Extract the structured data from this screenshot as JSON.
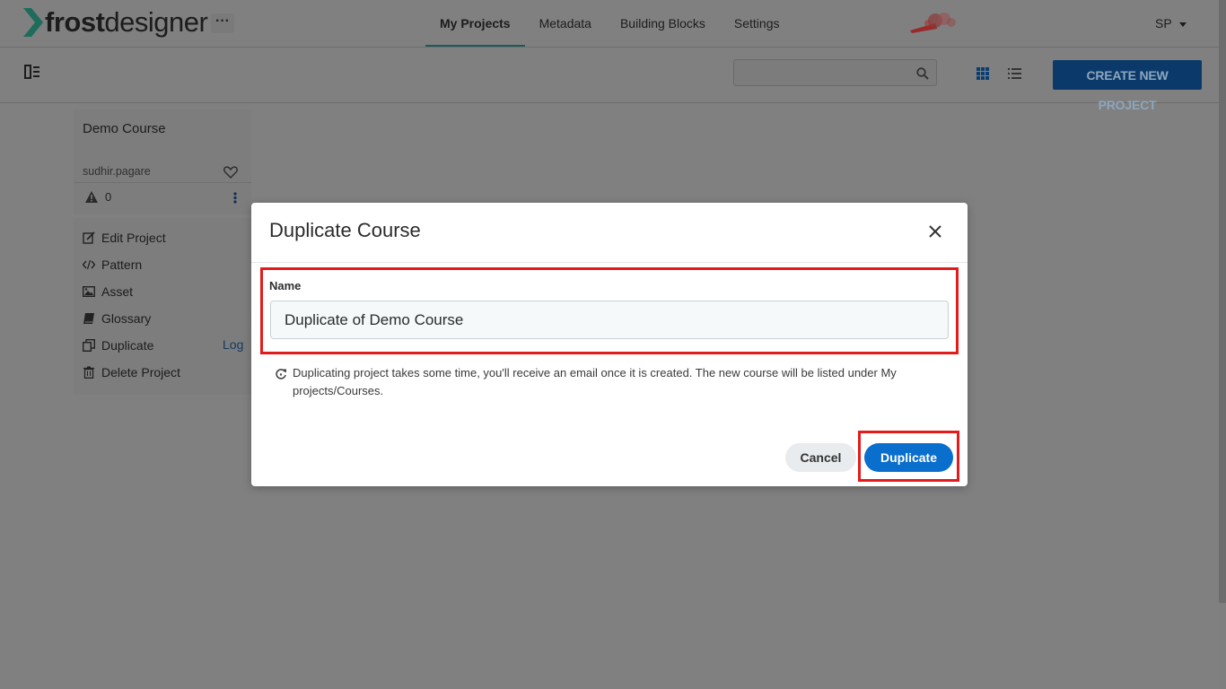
{
  "header": {
    "logo_bold": "frost",
    "logo_light": "designer",
    "more_label": "···",
    "nav": [
      {
        "label": "My Projects",
        "active": true
      },
      {
        "label": "Metadata",
        "active": false
      },
      {
        "label": "Building Blocks",
        "active": false
      },
      {
        "label": "Settings",
        "active": false
      }
    ],
    "user_initials": "SP"
  },
  "toolbar": {
    "search_placeholder": "",
    "create_label": "CREATE NEW PROJECT"
  },
  "project_card": {
    "title": "Demo Course",
    "owner": "sudhir.pagare",
    "warning_count": "0"
  },
  "context_menu": {
    "items": [
      {
        "label": "Edit Project",
        "icon": "edit-icon"
      },
      {
        "label": "Pattern",
        "icon": "code-icon"
      },
      {
        "label": "Asset",
        "icon": "image-icon"
      },
      {
        "label": "Glossary",
        "icon": "book-icon"
      },
      {
        "label": "Duplicate",
        "icon": "copy-icon"
      },
      {
        "label": "Delete Project",
        "icon": "trash-icon"
      }
    ],
    "log_label": "Log"
  },
  "modal": {
    "title": "Duplicate Course",
    "name_label": "Name",
    "name_value": "Duplicate of Demo Course",
    "info_text": "Duplicating project takes some time, you'll receive an email once it is created. The new course will be listed under My projects/Courses.",
    "cancel_label": "Cancel",
    "duplicate_label": "Duplicate"
  },
  "colors": {
    "primary": "#0a6ecc",
    "highlight": "#e41b1b",
    "overlay": "#808080"
  }
}
